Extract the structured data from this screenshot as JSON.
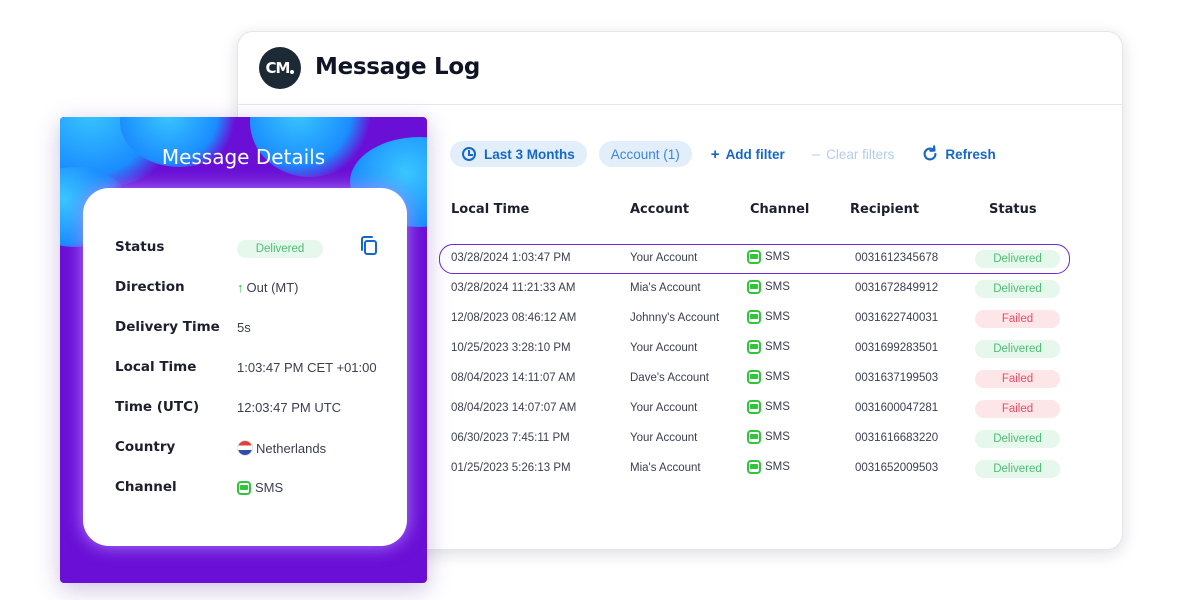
{
  "log": {
    "title": "Message Log",
    "logo_text": "CM",
    "filters": {
      "date_range": "Last 3 Months",
      "account": "Account (1)",
      "add_filter": "Add filter",
      "clear_filters": "Clear filters",
      "refresh": "Refresh"
    },
    "columns": [
      "Local Time",
      "Account",
      "Channel",
      "Recipient",
      "Status"
    ],
    "rows": [
      {
        "time": "03/28/2024 1:03:47 PM",
        "account": "Your Account",
        "channel": "SMS",
        "recipient": "0031612345678",
        "status": "Delivered",
        "selected": true
      },
      {
        "time": "03/28/2024 11:21:33 AM",
        "account": "Mia's Account",
        "channel": "SMS",
        "recipient": "0031672849912",
        "status": "Delivered"
      },
      {
        "time": "12/08/2023 08:46:12 AM",
        "account": "Johnny's Account",
        "channel": "SMS",
        "recipient": "0031622740031",
        "status": "Failed"
      },
      {
        "time": "10/25/2023 3:28:10 PM",
        "account": "Your Account",
        "channel": "SMS",
        "recipient": "0031699283501",
        "status": "Delivered"
      },
      {
        "time": "08/04/2023 14:11:07 AM",
        "account": "Dave's Account",
        "channel": "SMS",
        "recipient": "0031637199503",
        "status": "Failed"
      },
      {
        "time": "08/04/2023 14:07:07 AM",
        "account": "Your Account",
        "channel": "SMS",
        "recipient": "0031600047281",
        "status": "Failed"
      },
      {
        "time": "06/30/2023 7:45:11 PM",
        "account": "Your Account",
        "channel": "SMS",
        "recipient": "0031616683220",
        "status": "Delivered"
      },
      {
        "time": "01/25/2023 5:26:13 PM",
        "account": "Mia's Account",
        "channel": "SMS",
        "recipient": "0031652009503",
        "status": "Delivered"
      }
    ]
  },
  "details": {
    "title": "Message Details",
    "fields": [
      {
        "label": "Status",
        "value": "Delivered",
        "kind": "badge"
      },
      {
        "label": "Direction",
        "value": "Out (MT)",
        "kind": "direction"
      },
      {
        "label": "Delivery Time",
        "value": "5s",
        "kind": "text"
      },
      {
        "label": "Local Time",
        "value": "1:03:47 PM CET +01:00",
        "kind": "text"
      },
      {
        "label": "Time (UTC)",
        "value": "12:03:47 PM UTC",
        "kind": "text"
      },
      {
        "label": "Country",
        "value": "Netherlands",
        "kind": "flag"
      },
      {
        "label": "Channel",
        "value": "SMS",
        "kind": "sms"
      }
    ]
  },
  "colors": {
    "accent_blue": "#1668c7",
    "brand_purple": "#6a0fd6",
    "delivered": "#4fbd76",
    "failed": "#e05068",
    "sms_green": "#30c53a"
  }
}
